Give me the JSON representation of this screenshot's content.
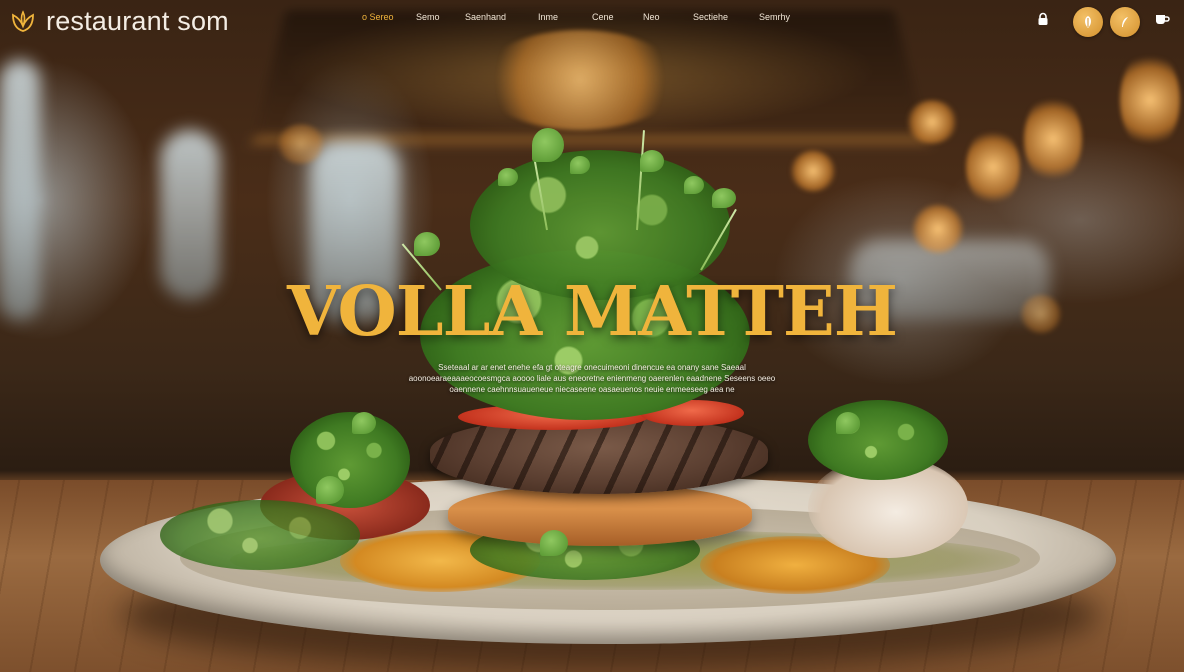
{
  "brand": {
    "name": "restaurant som",
    "icon": "lotus-logo-icon"
  },
  "nav": {
    "items": [
      {
        "label": "o Sereo",
        "active": true
      },
      {
        "label": "Semo",
        "active": false
      },
      {
        "label": "Saenhand",
        "active": false
      },
      {
        "label": "Inme",
        "active": false
      },
      {
        "label": "Cene",
        "active": false
      },
      {
        "label": "Neo",
        "active": false
      },
      {
        "label": "Sectiehe",
        "active": false
      },
      {
        "label": "Semrhy",
        "active": false
      }
    ]
  },
  "actions": {
    "lock_icon": "lock-icon",
    "button1_icon": "leaf-icon",
    "button2_icon": "feather-icon",
    "cup_icon": "cup-icon"
  },
  "hero": {
    "title": "VOLLA MATTEH",
    "description": "Sseteaal ar ar enet enehe efa gt oteagre onecuimeoni dinencue ea onany sane Saeaal aoonoearaeaaaeocoesmgca aoooo liale aus eneoretne enienmeng oaerenlen eaadnene Seseens oeeo oaennene caehnnsuaueneue niecaseene oasaeuenos neuie enmeeseeg aea ne"
  },
  "colors": {
    "accent": "#f0b43c",
    "text": "#f4ede4"
  }
}
